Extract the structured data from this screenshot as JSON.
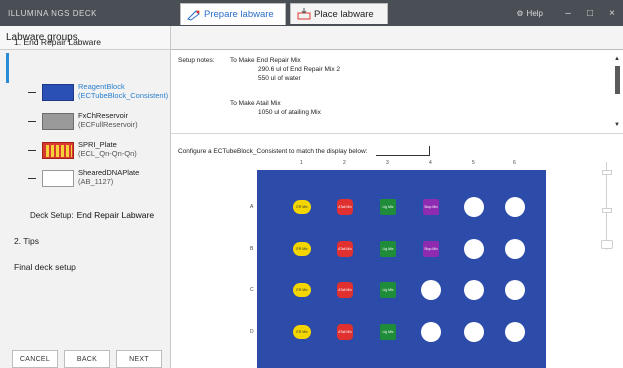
{
  "titlebar": {
    "title": "ILLUMINA NGS DECK",
    "help": "Help",
    "min": "–",
    "max": "□",
    "close": "×"
  },
  "left": {
    "header": "Labware groups",
    "step1": "1. End Repair Labware",
    "labware": [
      {
        "name": "ReagentBlock",
        "sub": "(ECTubeBlock_Consistent)",
        "color": "blue",
        "selected": true
      },
      {
        "name": "FxChReservoir",
        "sub": "(ECFullReservoir)",
        "color": "grey",
        "selected": false
      },
      {
        "name": "SPRI_Plate",
        "sub": "(ECL_Qn-Qn-Qn)",
        "color": "red",
        "selected": false
      },
      {
        "name": "ShearedDNAPlate",
        "sub": "(AB_1127)",
        "color": "white",
        "selected": false
      }
    ],
    "deck_label": "Deck Setup:",
    "deck_value": "End Repair Labware",
    "step2": "2. Tips",
    "final": "Final deck setup",
    "buttons": {
      "cancel": "CANCEL",
      "back": "BACK",
      "next": "NEXT"
    }
  },
  "tabs": [
    {
      "label": "Prepare labware",
      "active": true
    },
    {
      "label": "Place labware",
      "active": false
    }
  ],
  "notes": {
    "label": "Setup notes:",
    "line1": "To Make End Repair Mix",
    "line2": "290.6 ul of End Repair Mix 2",
    "line3": "550 ul of water",
    "line4": "To Make Atail Mix",
    "line5": "1050 ul of atailing Mix"
  },
  "config_text": "Configure a ECTubeBlock_Consistent to match the display below:",
  "plate": {
    "columns": [
      "1",
      "2",
      "3",
      "4",
      "5",
      "6"
    ],
    "rows": [
      "A",
      "B",
      "C",
      "D"
    ],
    "wells": [
      [
        "yellow",
        "red",
        "green",
        "purple",
        "empty",
        "empty"
      ],
      [
        "yellow",
        "red",
        "green",
        "purple",
        "empty",
        "empty"
      ],
      [
        "yellow",
        "red",
        "green",
        "empty",
        "empty",
        "empty"
      ],
      [
        "yellow",
        "red",
        "green",
        "empty",
        "empty",
        "empty"
      ]
    ],
    "well_labels": {
      "yellow": "ER Mix",
      "red": "ATail Mix",
      "green": "Lig Mix",
      "purple": "Stop Mix"
    }
  }
}
